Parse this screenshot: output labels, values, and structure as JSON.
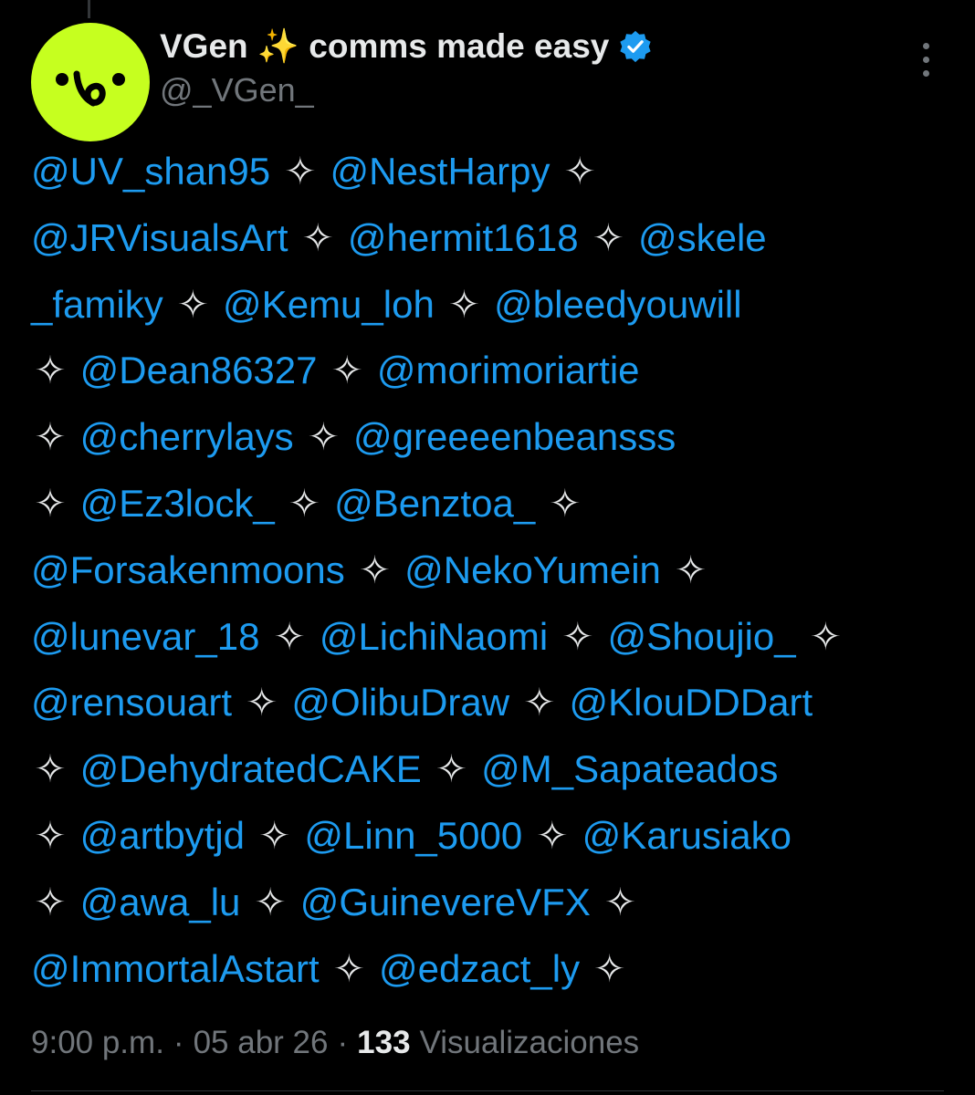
{
  "author": {
    "name": "VGen ✨ comms made easy",
    "handle": "@_VGen_",
    "verified": true,
    "avatar_color": "#c6ff1f"
  },
  "menu_icon": "more-vertical-icon",
  "separator": "✧",
  "mention_color": "#1d9bf0",
  "lines": [
    [
      {
        "m": "@UV_shan95"
      },
      {
        "s": 1
      },
      {
        "m": "@NestHarpy"
      },
      {
        "s": 1
      }
    ],
    [
      {
        "m": "@JRVisualsArt"
      },
      {
        "s": 1
      },
      {
        "m": "@hermit1618"
      },
      {
        "s": 1
      },
      {
        "m": "@skele"
      }
    ],
    [
      {
        "m": "_famiky"
      },
      {
        "s": 1
      },
      {
        "m": "@Kemu_loh"
      },
      {
        "s": 1
      },
      {
        "m": "@bleedyouwill"
      }
    ],
    [
      {
        "s": 1
      },
      {
        "m": "@Dean86327"
      },
      {
        "s": 1
      },
      {
        "m": "@morimoriartie"
      }
    ],
    [
      {
        "s": 1
      },
      {
        "m": "@cherrylays"
      },
      {
        "s": 1
      },
      {
        "m": "@greeeenbeansss"
      }
    ],
    [
      {
        "s": 1
      },
      {
        "m": "@Ez3lock_"
      },
      {
        "s": 1
      },
      {
        "m": "@Benztoa_"
      },
      {
        "s": 1
      }
    ],
    [
      {
        "m": "@Forsakenmoons"
      },
      {
        "s": 1
      },
      {
        "m": "@NekoYumein"
      },
      {
        "s": 1
      }
    ],
    [
      {
        "m": "@lunevar_18"
      },
      {
        "s": 1
      },
      {
        "m": "@LichiNaomi"
      },
      {
        "s": 1
      },
      {
        "m": "@Shoujio_"
      },
      {
        "s": 1
      }
    ],
    [
      {
        "m": "@rensouart"
      },
      {
        "s": 1
      },
      {
        "m": "@OlibuDraw"
      },
      {
        "s": 1
      },
      {
        "m": "@KlouDDDart"
      }
    ],
    [
      {
        "s": 1
      },
      {
        "m": "@DehydratedCAKE"
      },
      {
        "s": 1
      },
      {
        "m": "@M_Sapateados"
      }
    ],
    [
      {
        "s": 1
      },
      {
        "m": "@artbytjd"
      },
      {
        "s": 1
      },
      {
        "m": "@Linn_5000"
      },
      {
        "s": 1
      },
      {
        "m": "@Karusiako"
      }
    ],
    [
      {
        "s": 1
      },
      {
        "m": "@awa_lu"
      },
      {
        "s": 1
      },
      {
        "m": "@GuinevereVFX"
      },
      {
        "s": 1
      }
    ],
    [
      {
        "m": "@ImmortalAstart"
      },
      {
        "s": 1
      },
      {
        "m": "@edzact_ly"
      },
      {
        "s": 1
      }
    ]
  ],
  "meta": {
    "time": "9:00 p.m.",
    "date": "05 abr 26",
    "views_count": "133",
    "views_label": "Visualizaciones",
    "dot": "·"
  }
}
